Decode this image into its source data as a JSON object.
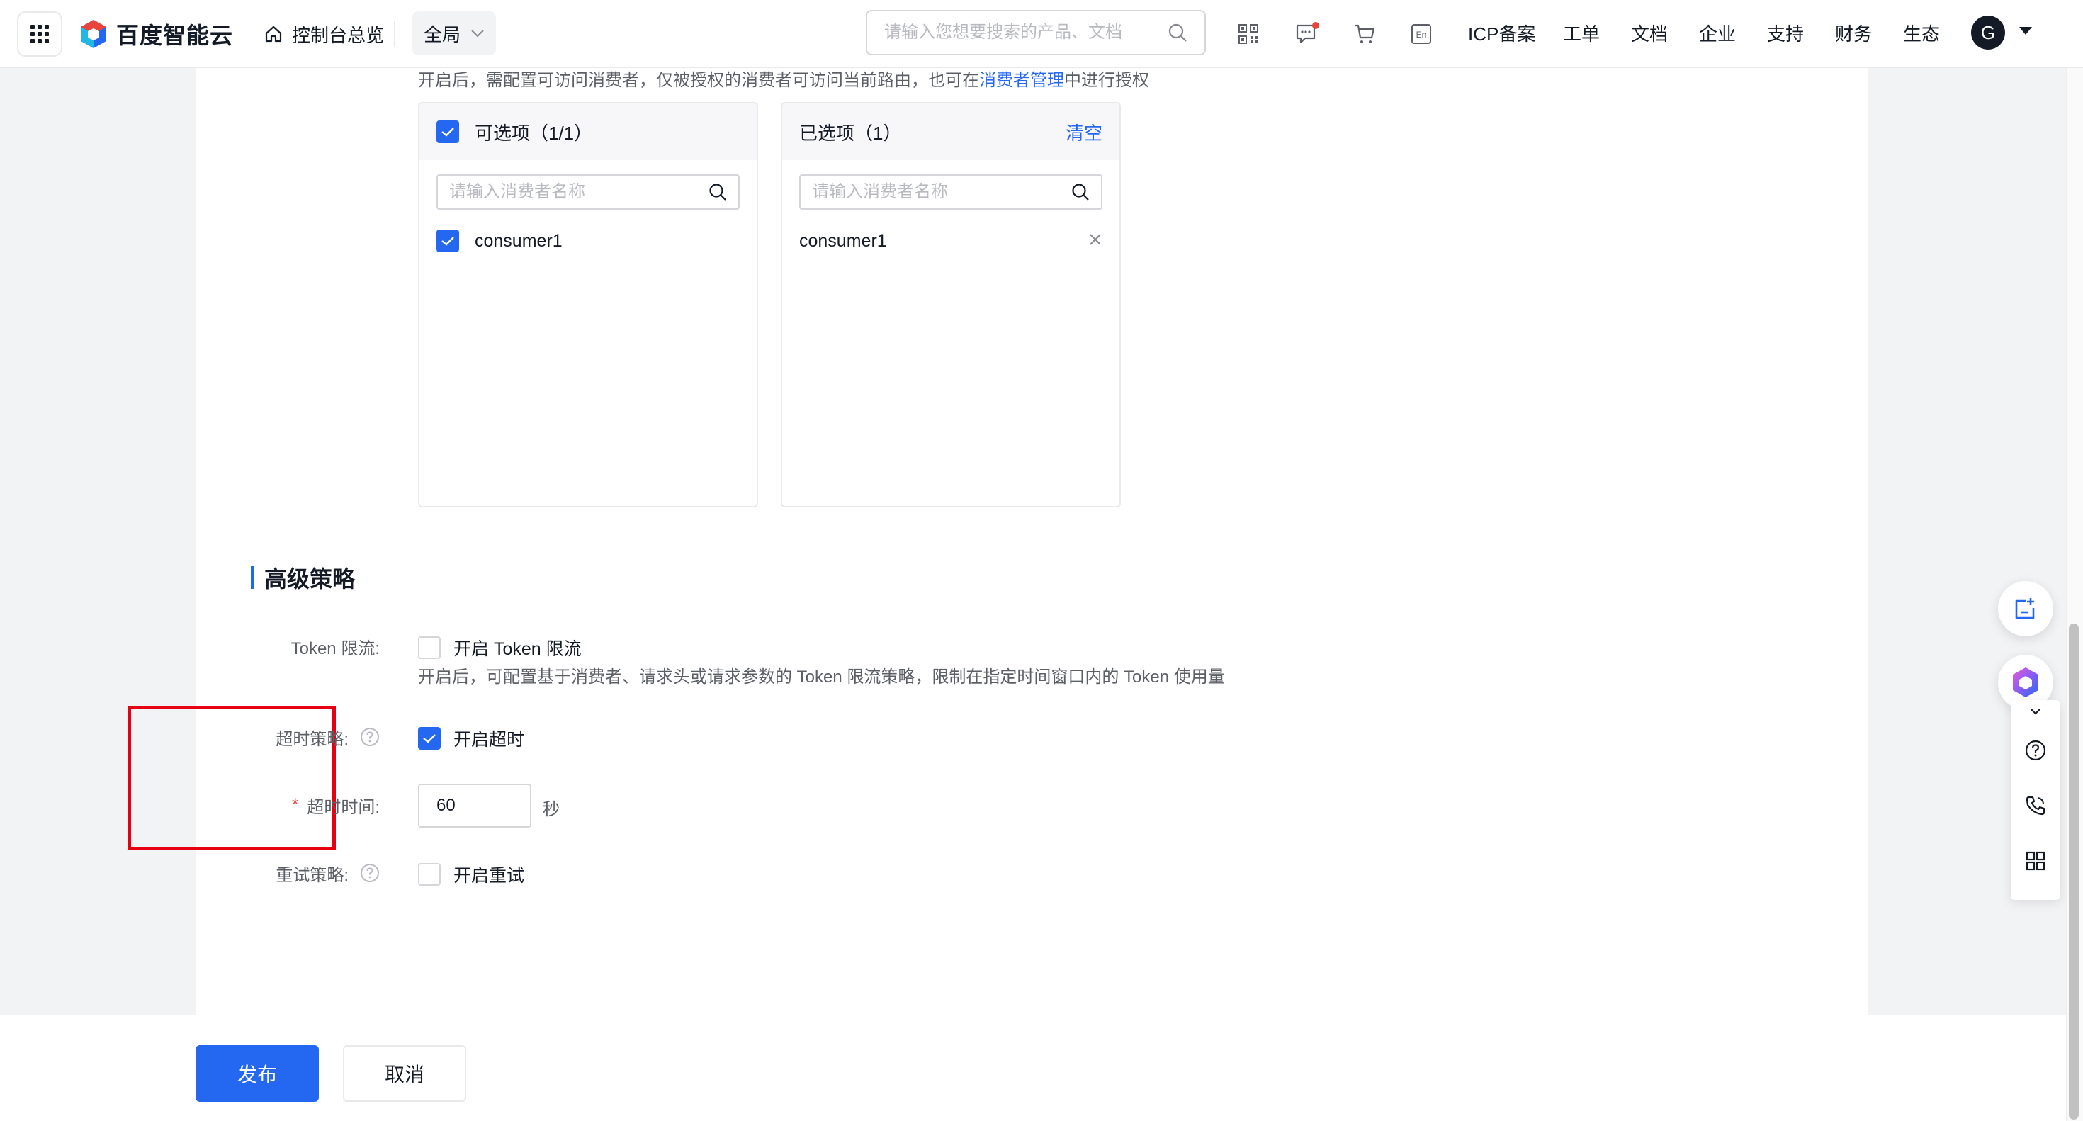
{
  "header": {
    "brand": "百度智能云",
    "console_home": "控制台总览",
    "region": "全局",
    "search_placeholder": "请输入您想要搜索的产品、文档",
    "nav_links": [
      "ICP备案",
      "工单",
      "文档",
      "企业",
      "支持",
      "财务",
      "生态"
    ],
    "avatar_initial": "G",
    "icons": [
      "apps-grid-icon",
      "qrcode-icon",
      "message-icon",
      "cart-icon",
      "language-en-icon"
    ],
    "language_icon_text": "En"
  },
  "consumer_auth": {
    "description_prefix": "开启后，需配置可访问消费者，仅被授权的消费者可访问当前路由，也可在",
    "description_link": "消费者管理",
    "description_suffix": "中进行授权",
    "available_panel": {
      "title": "可选项（1/1）",
      "search_placeholder": "请输入消费者名称",
      "items": [
        {
          "label": "consumer1",
          "checked": true
        }
      ]
    },
    "selected_panel": {
      "title": "已选项（1）",
      "clear_label": "清空",
      "search_placeholder": "请输入消费者名称",
      "items": [
        {
          "label": "consumer1"
        }
      ]
    }
  },
  "advanced": {
    "section_title": "高级策略",
    "token_limit": {
      "label": "Token 限流:",
      "checkbox_label": "开启 Token 限流",
      "checked": false,
      "description": "开启后，可配置基于消费者、请求头或请求参数的 Token 限流策略，限制在指定时间窗口内的 Token 使用量"
    },
    "timeout": {
      "label": "超时策略:",
      "checkbox_label": "开启超时",
      "checked": true
    },
    "timeout_value": {
      "label": "超时时间:",
      "required_mark": "*",
      "value": "60",
      "unit": "秒"
    },
    "retry": {
      "label": "重试策略:",
      "checkbox_label": "开启重试",
      "checked": false
    }
  },
  "footer": {
    "publish_label": "发布",
    "cancel_label": "取消"
  },
  "colors": {
    "primary": "#2468f2",
    "highlight": "#e60012",
    "required": "#e8443d"
  }
}
